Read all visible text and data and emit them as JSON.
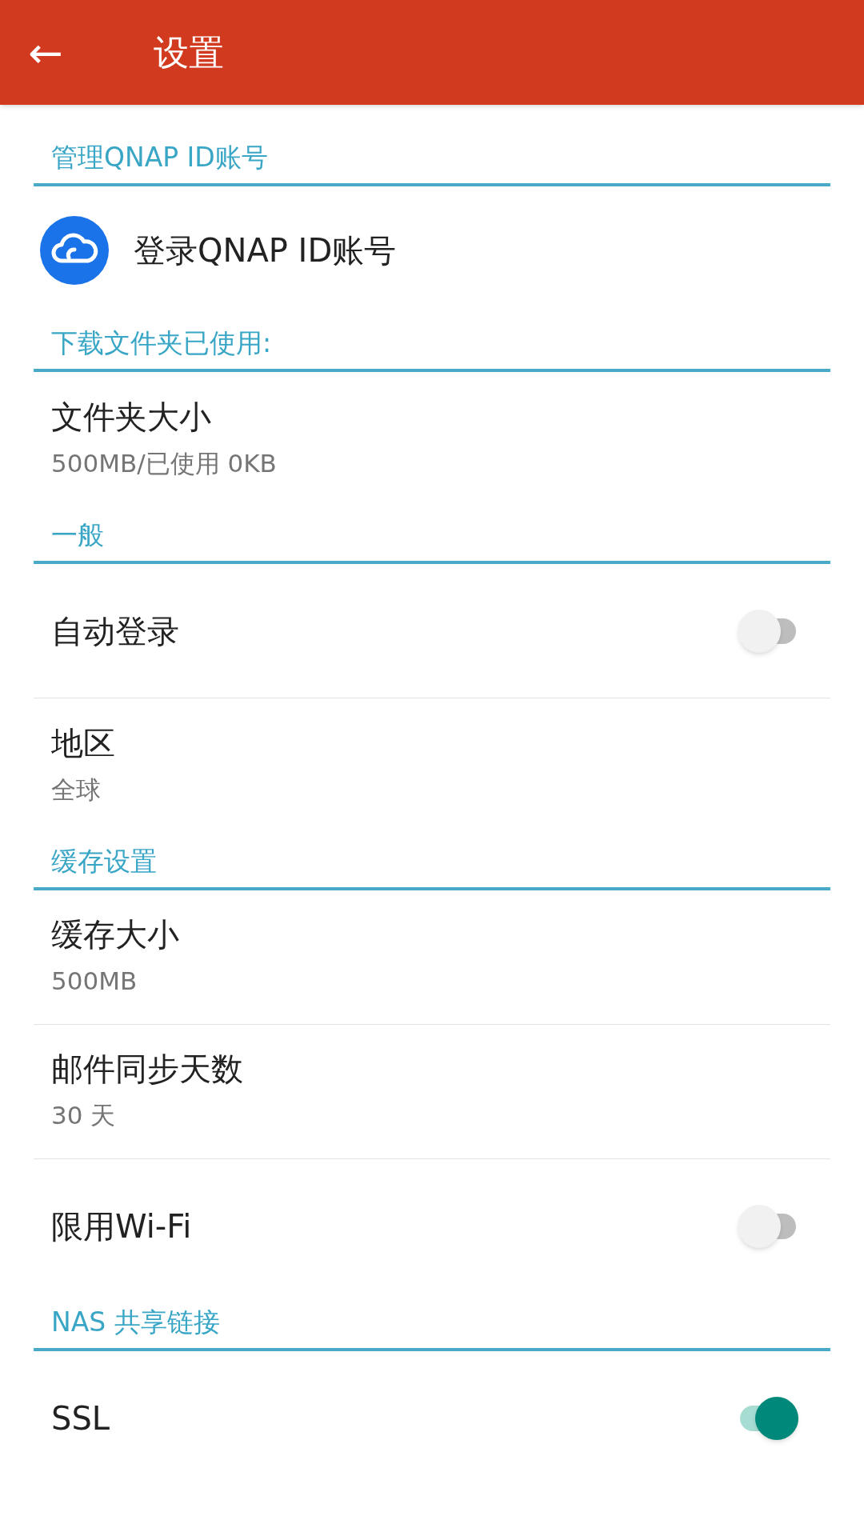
{
  "app_bar": {
    "back_icon": "←",
    "title": "设置"
  },
  "sections": [
    {
      "title": "管理QNAP ID账号",
      "items": [
        {
          "kind": "account",
          "label": "登录QNAP ID账号"
        }
      ]
    },
    {
      "title": "下载文件夹已使用:",
      "items": [
        {
          "kind": "detail",
          "label": "文件夹大小",
          "value": "500MB/已使用 0KB"
        }
      ]
    },
    {
      "title": "一般",
      "items": [
        {
          "kind": "toggle",
          "label": "自动登录",
          "on": false
        },
        {
          "kind": "detail",
          "label": "地区",
          "value": "全球"
        }
      ]
    },
    {
      "title": "缓存设置",
      "items": [
        {
          "kind": "detail",
          "label": "缓存大小",
          "value": "500MB"
        },
        {
          "kind": "detail",
          "label": "邮件同步天数",
          "value": "30 天"
        },
        {
          "kind": "toggle",
          "label": "限用Wi-Fi",
          "on": false
        }
      ]
    },
    {
      "title": "NAS 共享链接",
      "items": [
        {
          "kind": "toggle",
          "label": "SSL",
          "on": true
        }
      ]
    }
  ]
}
